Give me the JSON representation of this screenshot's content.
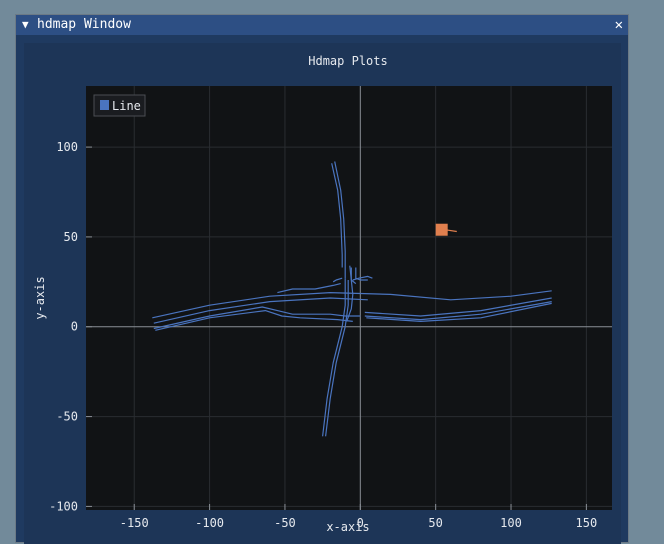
{
  "window": {
    "title": "hdmap Window",
    "collapse_icon": "triangle-down-icon",
    "close_icon": "close-icon"
  },
  "colors": {
    "desktop": "#728a9a",
    "window_bg": "#1f3a60",
    "titlebar": "#2d4f84",
    "plot_bg": "#111315",
    "line": "#4a74bf",
    "marker": "#e07f4e"
  },
  "chart_data": {
    "type": "line",
    "title": "Hdmap Plots",
    "xlabel": "x-axis",
    "ylabel": "y-axis",
    "xlim": [
      -182,
      167
    ],
    "ylim": [
      -102,
      134
    ],
    "x_ticks": [
      -150,
      -100,
      -50,
      0,
      50,
      100,
      150
    ],
    "y_ticks": [
      -100,
      -50,
      0,
      50,
      100
    ],
    "grid": true,
    "legend": {
      "entries": [
        "Line"
      ],
      "placement": "top-left"
    },
    "series": [
      {
        "name": "Line",
        "lines": [
          [
            [
              -138,
              5
            ],
            [
              -100,
              12
            ],
            [
              -60,
              17
            ],
            [
              -20,
              19
            ],
            [
              20,
              18
            ],
            [
              60,
              15
            ],
            [
              100,
              17
            ],
            [
              127,
              20
            ]
          ],
          [
            [
              -137,
              2
            ],
            [
              -100,
              9
            ],
            [
              -60,
              14
            ],
            [
              -20,
              16
            ],
            [
              5,
              15
            ]
          ],
          [
            [
              -137,
              -1
            ],
            [
              -100,
              6
            ],
            [
              -65,
              11
            ],
            [
              -55,
              9
            ],
            [
              -45,
              7
            ],
            [
              -20,
              7
            ],
            [
              -10,
              6
            ],
            [
              0,
              6
            ]
          ],
          [
            [
              -136,
              -2
            ],
            [
              -100,
              5
            ],
            [
              -63,
              9
            ],
            [
              -52,
              6
            ],
            [
              -40,
              5
            ],
            [
              -15,
              4
            ],
            [
              -5,
              3
            ]
          ],
          [
            [
              3,
              8
            ],
            [
              40,
              6
            ],
            [
              80,
              9
            ],
            [
              127,
              16
            ]
          ],
          [
            [
              3,
              6
            ],
            [
              40,
              4
            ],
            [
              80,
              7
            ],
            [
              127,
              14
            ]
          ],
          [
            [
              4,
              5
            ],
            [
              40,
              3
            ],
            [
              80,
              5
            ],
            [
              127,
              13
            ]
          ],
          [
            [
              -55,
              19
            ],
            [
              -45,
              21
            ],
            [
              -30,
              21
            ],
            [
              -18,
              23
            ],
            [
              -13,
              24
            ]
          ],
          [
            [
              -19,
              91
            ],
            [
              -15,
              76
            ],
            [
              -13,
              60
            ],
            [
              -12,
              40
            ],
            [
              -12,
              33
            ]
          ],
          [
            [
              -17,
              92
            ],
            [
              -13,
              76
            ],
            [
              -11,
              60
            ],
            [
              -10,
              42
            ],
            [
              -10,
              27
            ]
          ],
          [
            [
              -10,
              27
            ],
            [
              -10,
              12
            ],
            [
              -12,
              0
            ],
            [
              -18,
              -20
            ],
            [
              -22,
              -40
            ],
            [
              -25,
              -61
            ]
          ],
          [
            [
              -8,
              26
            ],
            [
              -8,
              12
            ],
            [
              -10,
              0
            ],
            [
              -16,
              -20
            ],
            [
              -20,
              -40
            ],
            [
              -23,
              -61
            ]
          ],
          [
            [
              -12,
              27
            ],
            [
              -16,
              26
            ],
            [
              -18,
              25
            ]
          ],
          [
            [
              -6,
              33
            ],
            [
              -6,
              26
            ],
            [
              -3,
              24
            ]
          ],
          [
            [
              -3,
              33
            ],
            [
              -3,
              27
            ],
            [
              0,
              26
            ],
            [
              5,
              26
            ]
          ],
          [
            [
              -7,
              34
            ],
            [
              -6,
              26
            ],
            [
              -5,
              18
            ],
            [
              -6,
              10
            ],
            [
              -9,
              3
            ]
          ],
          [
            [
              -5,
              26
            ],
            [
              -1,
              27
            ],
            [
              5,
              28
            ],
            [
              8,
              27
            ]
          ]
        ]
      }
    ],
    "marker": {
      "x": 54,
      "y": 54,
      "tail": [
        [
          56,
          54
        ],
        [
          64,
          53
        ]
      ]
    }
  }
}
